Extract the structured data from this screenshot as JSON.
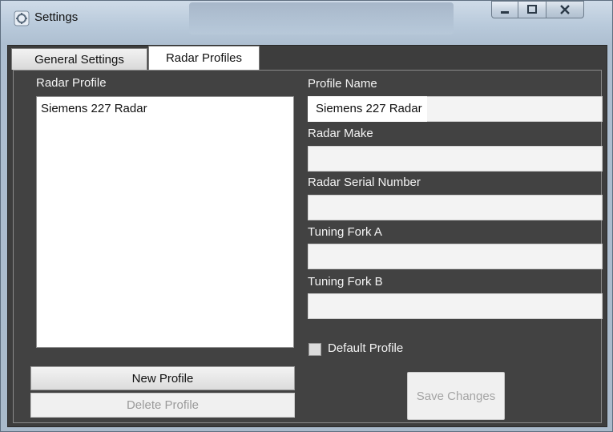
{
  "window": {
    "title": "Settings",
    "app_icon": "settings-app-icon",
    "caption_buttons": {
      "minimize_icon": "minimize-icon",
      "maximize_icon": "maximize-icon",
      "close_icon": "close-icon"
    }
  },
  "tabs": [
    {
      "label": "General Settings",
      "selected": false
    },
    {
      "label": "Radar Profiles",
      "selected": true
    }
  ],
  "radar_profiles": {
    "list_label": "Radar Profile",
    "profiles": [
      "Siemens 227 Radar"
    ],
    "fields": {
      "profile_name": {
        "label": "Profile Name",
        "value": "Siemens 227 Radar"
      },
      "radar_make": {
        "label": "Radar Make",
        "value": ""
      },
      "radar_serial_number": {
        "label": "Radar Serial Number",
        "value": ""
      },
      "tuning_fork_a": {
        "label": "Tuning Fork A",
        "value": ""
      },
      "tuning_fork_b": {
        "label": "Tuning Fork B",
        "value": ""
      }
    },
    "default_profile": {
      "label": "Default Profile",
      "checked": false
    },
    "buttons": {
      "new_profile": "New Profile",
      "delete_profile": "Delete Profile",
      "save_changes": "Save Changes"
    }
  },
  "colors": {
    "panel_background": "#424242",
    "label_text": "#f4f4f4",
    "disabled_text": "#9a9a9a"
  }
}
